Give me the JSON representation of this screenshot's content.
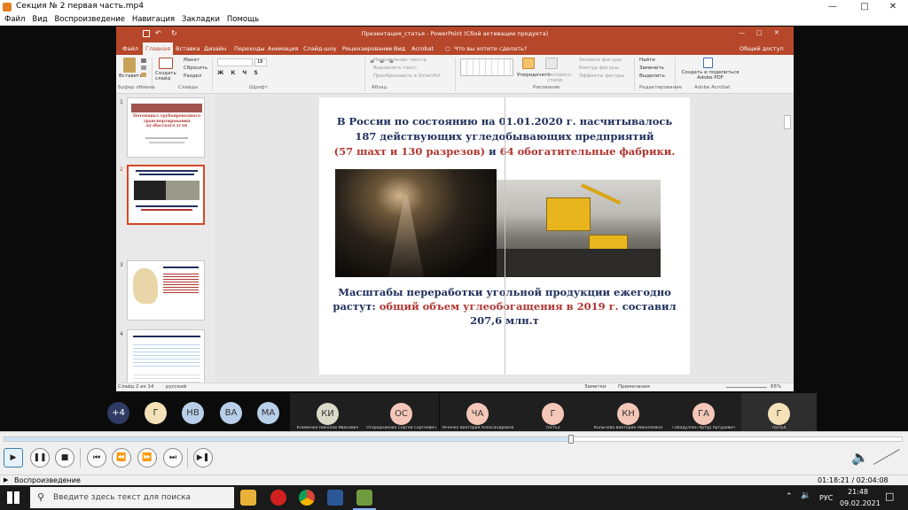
{
  "window": {
    "title": "Секция № 2 первая часть.mp4",
    "menu": [
      "Файл",
      "Вид",
      "Воспроизведение",
      "Навигация",
      "Закладки",
      "Помощь"
    ]
  },
  "ppt": {
    "title": "Презентация_статья - PowerPoint (Сбой активации продукта)",
    "tabs": [
      "Файл",
      "Главная",
      "Вставка",
      "Дизайн",
      "Переходы",
      "Анимация",
      "Слайд-шоу",
      "Рецензирование",
      "Вид",
      "Acrobat"
    ],
    "tell_me": "Что вы хотите сделать?",
    "share": "Общий доступ",
    "ribbon": {
      "paste": "Вставить",
      "create_slide": "Создать слайд",
      "layout": "Макет",
      "reset": "Сбросить",
      "section": "Раздел",
      "font_size": "18",
      "text_direction": "Направление текста",
      "align_text": "Выровнять текст",
      "smartart": "Преобразовать в SmartArt",
      "arrange": "Упорядочить",
      "quick_styles": "Экспресс-стили",
      "shape_fill": "Заливка фигуры",
      "shape_outline": "Контур фигуры",
      "shape_effects": "Эффекты фигуры",
      "find": "Найти",
      "replace": "Заменить",
      "select": "Выделить",
      "adobe_pdf": "Создать и поделиться Adobe PDF",
      "groups": [
        "Буфер обмена",
        "Слайды",
        "Шрифт",
        "Абзац",
        "Рисование",
        "Редактирование",
        "Adobe Acrobat"
      ]
    },
    "thumbnails": [
      {
        "num": "1",
        "title": "Потенциал трубопроводного транспортирования кузбасского угля"
      },
      {
        "num": "2",
        "title": ""
      },
      {
        "num": "3",
        "title": ""
      },
      {
        "num": "4",
        "title": ""
      }
    ],
    "slide": {
      "line1": "В России по состоянию на 01.01.2020 г. насчитывалось",
      "line2": "187 действующих угледобывающих предприятий",
      "line3_red_a": "(57 шахт и 130 разрезов)",
      "line3_mid": " и ",
      "line3_red_b": "64 обогатительные фабрики.",
      "line4": "Масштабы переработки угольной продукции ежегодно",
      "line5_a": "растут: ",
      "line5_red": "общий объем углеобогащения в 2019 г.",
      "line5_b": " составил",
      "line6": "207,6 млн.т"
    },
    "status": {
      "slide_of": "Слайд 2 из 14",
      "lang": "русский",
      "notes": "Заметки",
      "comments": "Примечания",
      "zoom": "65%"
    }
  },
  "participants": [
    {
      "initials": "+4",
      "name": "",
      "color": "#2f3b63"
    },
    {
      "initials": "Г",
      "name": "",
      "color": "#f5e1b8"
    },
    {
      "initials": "НВ",
      "name": "",
      "color": "#b7cfe8"
    },
    {
      "initials": "ВА",
      "name": "",
      "color": "#b7cfe8"
    },
    {
      "initials": "МА",
      "name": "",
      "color": "#b7cfe8"
    },
    {
      "initials": "КИ",
      "name": "Клименко Николай Иванович",
      "color": "#d9dac8"
    },
    {
      "initials": "ОС",
      "name": "Огородникова Сергей Сергеевич",
      "color": "#f4c7b8"
    },
    {
      "initials": "ЧА",
      "name": "Чеченко Виктория Александровна",
      "color": "#f4c7b8"
    },
    {
      "initials": "Г",
      "name": "гость3",
      "color": "#f4c7b8"
    },
    {
      "initials": "КН",
      "name": "Колычева Виктория Николаевна",
      "color": "#f4c7b8"
    },
    {
      "initials": "ГА",
      "name": "Гибадуллин Артур Артурович",
      "color": "#f4c7b8"
    },
    {
      "initials": "Г",
      "name": "гость4",
      "color": "#f5e1b8"
    }
  ],
  "player": {
    "status": "Воспроизведение",
    "time": "01:18:21 / 02:04:08",
    "progress": 0.631
  },
  "taskbar": {
    "search_placeholder": "Введите здесь текст для поиска",
    "lang": "РУС",
    "time": "21:48",
    "date": "09.02.2021"
  },
  "colors": {
    "ppt_accent": "#b7472a",
    "slide_text": "#1f2f5c",
    "slide_red": "#b0352f"
  }
}
